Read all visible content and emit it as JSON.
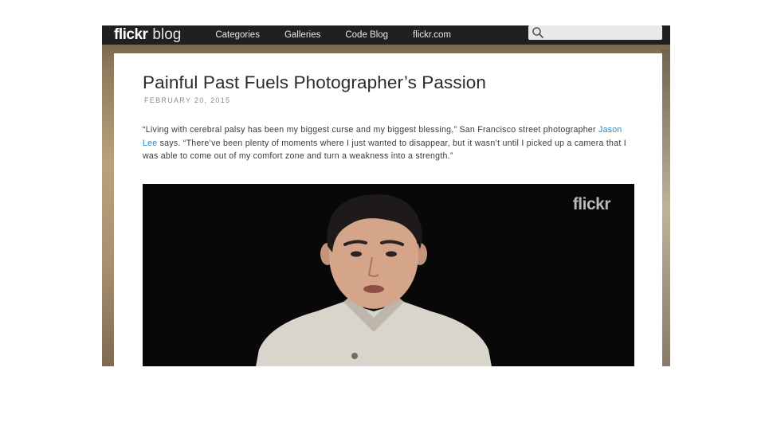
{
  "nav": {
    "brand_main": "flickr",
    "brand_sub": "blog",
    "links": [
      "Categories",
      "Galleries",
      "Code Blog",
      "flickr.com"
    ],
    "search": {
      "placeholder": "",
      "icon": "search-icon"
    }
  },
  "article": {
    "title": "Painful Past Fuels Photographer’s Passion",
    "date": "FEBRUARY 20, 2015",
    "body_before_link": "“Living with cerebral palsy has been my biggest curse and my biggest blessing,” San Francisco street photographer ",
    "link_text": "Jason Lee",
    "body_after_link": " says. “There’ve been plenty of moments where I just wanted to disappear, but it wasn’t until I picked up a camera that I was able to come out of my comfort zone and turn a weakness into a strength.”",
    "link_color": "#2e86c4"
  },
  "video": {
    "watermark": "flickr"
  }
}
